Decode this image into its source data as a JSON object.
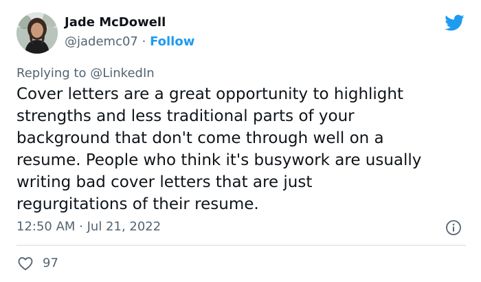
{
  "author": {
    "name": "Jade McDowell",
    "handle": "@jademc07",
    "separator": "·",
    "follow_label": "Follow"
  },
  "reply_context": {
    "prefix": "Replying to",
    "mention": "@LinkedIn"
  },
  "tweet": {
    "lines": [
      "Cover letters are a great opportunity to highlight",
      "strengths and less traditional parts of your",
      "background that don't come through well on a",
      "resume. People who think it's busywork are usually",
      "writing bad cover letters that are just",
      "regurgitations of their resume."
    ]
  },
  "meta": {
    "timestamp": "12:50 AM · Jul 21, 2022"
  },
  "stats": {
    "likes": "97"
  },
  "icons": {
    "logo": "twitter-bird-icon",
    "info": "info-icon",
    "like": "heart-icon"
  },
  "colors": {
    "accent": "#1d9bf0",
    "text_primary": "#0f1419",
    "text_secondary": "#536471",
    "divider": "#cfd9de"
  }
}
